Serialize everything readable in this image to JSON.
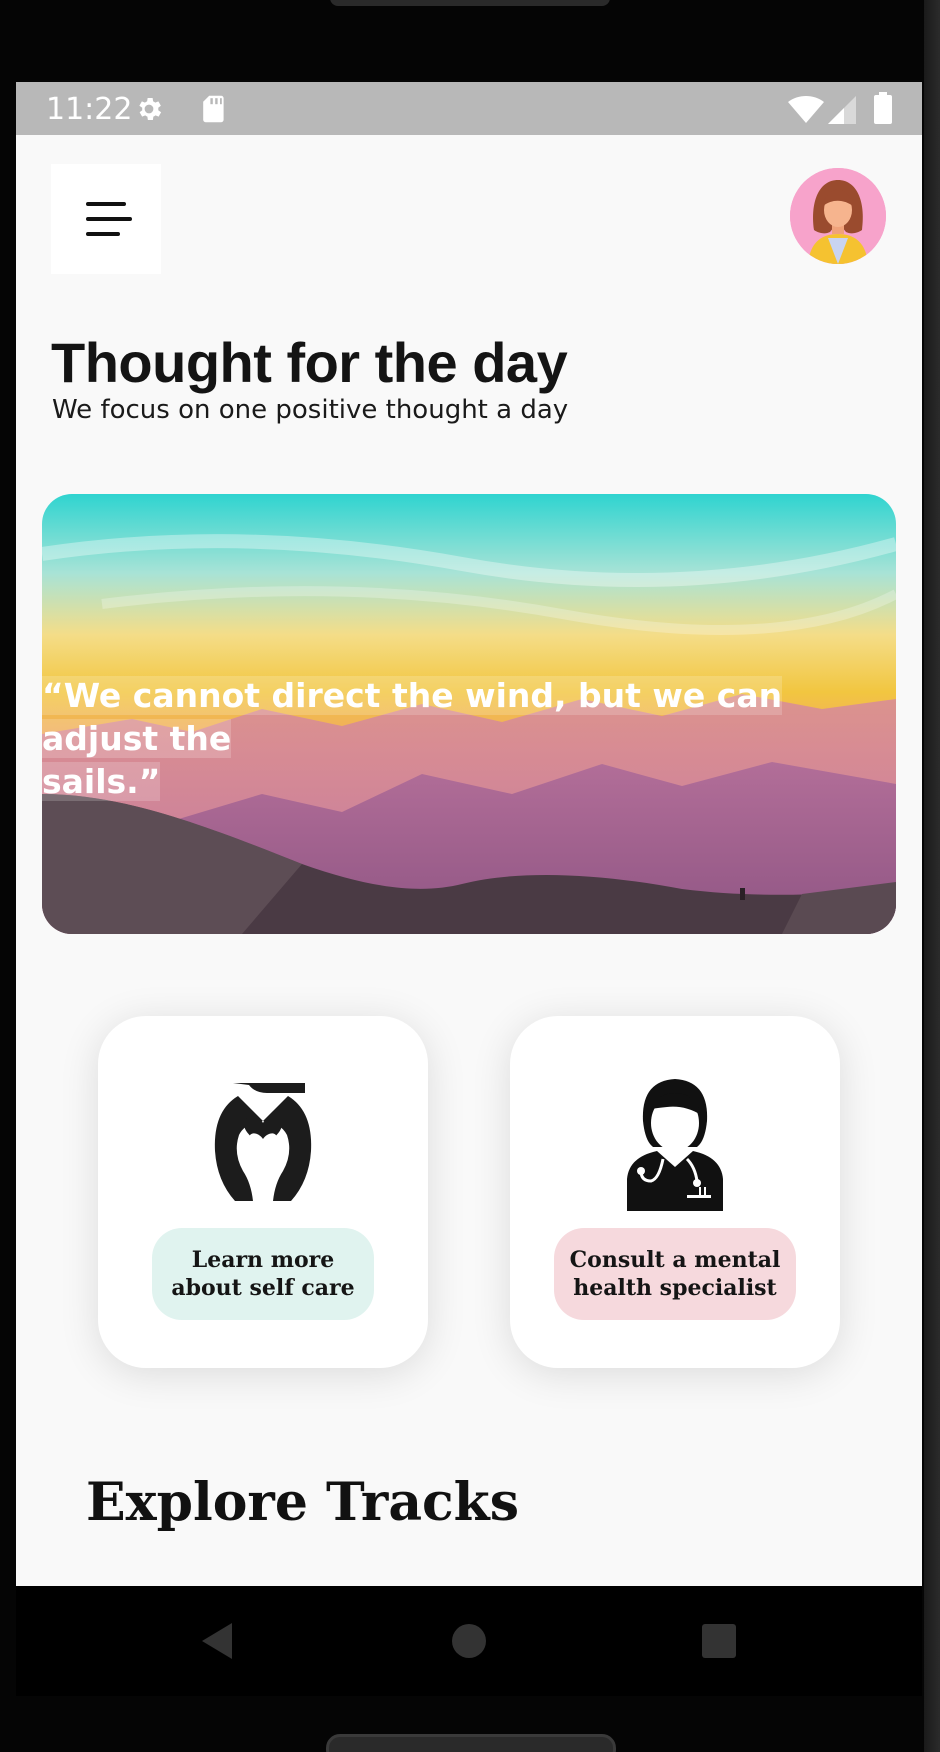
{
  "status_bar": {
    "time": "11:22",
    "icons": [
      "gear-icon",
      "sd-card-icon",
      "wifi-icon",
      "signal-icon",
      "battery-icon"
    ]
  },
  "header": {
    "menu_icon": "hamburger-menu-icon",
    "avatar": "user-avatar"
  },
  "hero": {
    "title": "Thought for the day",
    "subtitle": "We focus on one positive thought a day"
  },
  "quote_card": {
    "quote_line1": "“We cannot direct the wind, but we can adjust the",
    "quote_line2": "sails.”"
  },
  "actions": [
    {
      "label": "Learn more about self care",
      "icon": "caring-hands-heart-icon",
      "color": "#e0f3ef"
    },
    {
      "label": "Consult a mental health specialist",
      "icon": "doctor-icon",
      "color": "#f6d9dd"
    }
  ],
  "section": {
    "title": "Explore Tracks"
  },
  "navigation": {
    "icons": [
      "back-triangle-icon",
      "home-circle-icon",
      "recents-square-icon"
    ]
  }
}
